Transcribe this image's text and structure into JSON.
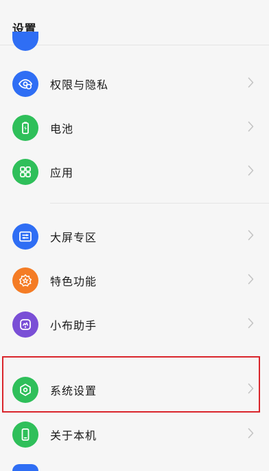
{
  "header": {
    "title": "设置"
  },
  "items": [
    {
      "label": "权限与隐私",
      "icon": "privacy-eye-icon",
      "color": "#2f6ef4"
    },
    {
      "label": "电池",
      "icon": "battery-icon",
      "color": "#2fbf5a"
    },
    {
      "label": "应用",
      "icon": "apps-grid-icon",
      "color": "#2fbf5a"
    },
    {
      "label": "大屏专区",
      "icon": "large-screen-icon",
      "color": "#2f6ef4"
    },
    {
      "label": "特色功能",
      "icon": "star-badge-icon",
      "color": "#f47c25"
    },
    {
      "label": "小布助手",
      "icon": "assistant-icon",
      "color": "#7a4fd6"
    },
    {
      "label": "系统设置",
      "icon": "system-settings-hexagon-icon",
      "color": "#2fbf5a"
    },
    {
      "label": "关于本机",
      "icon": "phone-icon",
      "color": "#2fbf5a"
    }
  ],
  "highlight_color": "#d9252b"
}
